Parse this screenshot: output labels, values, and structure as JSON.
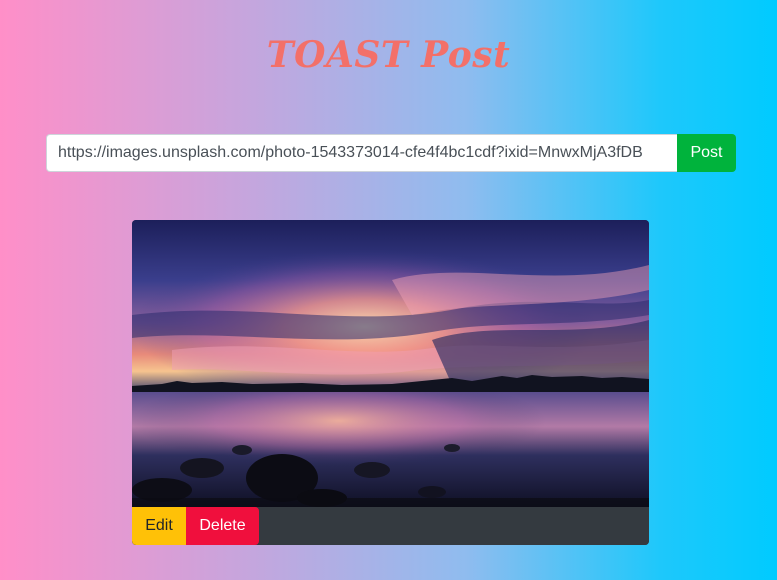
{
  "page": {
    "title": "TOAST Post"
  },
  "composer": {
    "url_value": "https://images.unsplash.com/photo-1543373014-cfe4f4bc1cdf?ixid=MnwxMjA3fDB",
    "post_label": "Post"
  },
  "post": {
    "image_subject": "sunset-over-lake-photo",
    "edit_label": "Edit",
    "delete_label": "Delete"
  },
  "colors": {
    "title": "#f37069",
    "post_button": "#00b33c",
    "edit_button": "#ffc107",
    "delete_button": "#f00f3d",
    "card_footer": "#343a40"
  }
}
